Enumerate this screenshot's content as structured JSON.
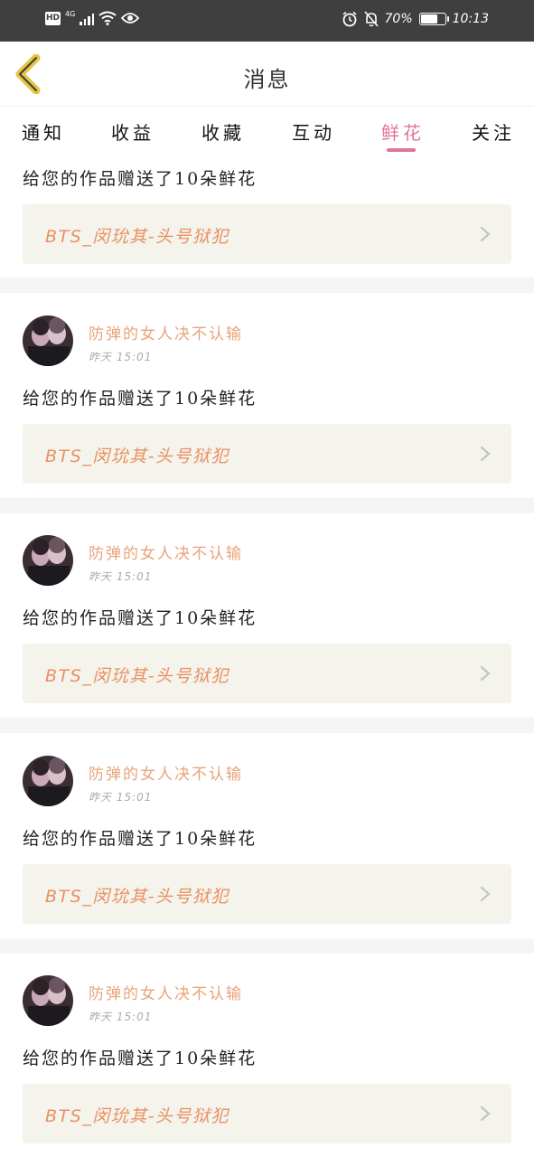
{
  "status_bar": {
    "hd": "HD",
    "network": "4G",
    "battery_percent_label": "70%",
    "battery_level": 0.7,
    "time": "10:13"
  },
  "header": {
    "title": "消息"
  },
  "tabs": [
    {
      "label": "通知",
      "active": false
    },
    {
      "label": "收益",
      "active": false
    },
    {
      "label": "收藏",
      "active": false
    },
    {
      "label": "互动",
      "active": false
    },
    {
      "label": "鲜花",
      "active": true
    },
    {
      "label": "关注",
      "active": false
    }
  ],
  "top_partial": {
    "message": "给您的作品赠送了10朵鲜花",
    "work_title": "BTS_闵玧其-头号狱犯"
  },
  "items": [
    {
      "user": "防弹的女人决不认输",
      "time": "昨天 15:01",
      "message": "给您的作品赠送了10朵鲜花",
      "work_title": "BTS_闵玧其-头号狱犯"
    },
    {
      "user": "防弹的女人决不认输",
      "time": "昨天 15:01",
      "message": "给您的作品赠送了10朵鲜花",
      "work_title": "BTS_闵玧其-头号狱犯"
    },
    {
      "user": "防弹的女人决不认输",
      "time": "昨天 15:01",
      "message": "给您的作品赠送了10朵鲜花",
      "work_title": "BTS_闵玧其-头号狱犯"
    },
    {
      "user": "防弹的女人决不认输",
      "time": "昨天 15:01",
      "message": "给您的作品赠送了10朵鲜花",
      "work_title": "BTS_闵玧其-头号狱犯"
    }
  ],
  "colors": {
    "accent": "#e2739d",
    "username": "#e8a37a",
    "work_title": "#ea9062",
    "card_bg": "#f4f3ec",
    "status_bar": "#3f3f3f"
  }
}
